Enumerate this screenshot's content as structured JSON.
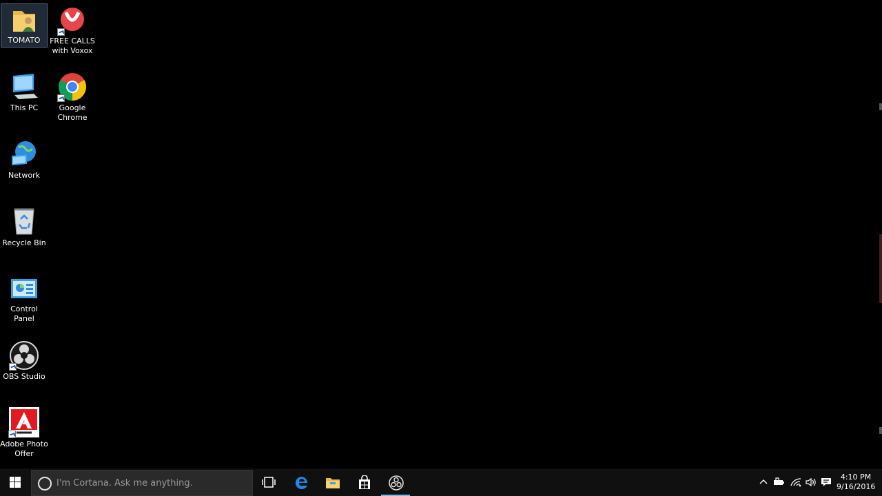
{
  "desktop_icons": [
    {
      "label": "TOMATO",
      "icon": "folder-user-icon"
    },
    {
      "label": "FREE CALLS with Voxox",
      "icon": "voxox-icon"
    },
    {
      "label": "This PC",
      "icon": "computer-icon"
    },
    {
      "label": "Google Chrome",
      "icon": "chrome-icon"
    },
    {
      "label": "Network",
      "icon": "network-icon"
    },
    {
      "label": "Recycle Bin",
      "icon": "recycle-bin-icon"
    },
    {
      "label": "Control Panel",
      "icon": "control-panel-icon"
    },
    {
      "label": "OBS Studio",
      "icon": "obs-icon"
    },
    {
      "label": "Adobe Photo Offer",
      "icon": "adobe-icon"
    }
  ],
  "taskbar": {
    "search_placeholder": "I'm Cortana. Ask me anything.",
    "apps": [
      "task-view-icon",
      "edge-icon",
      "file-explorer-icon",
      "store-icon",
      "obs-icon"
    ],
    "tray": [
      "chevron-up-icon",
      "battery-icon",
      "wifi-icon",
      "volume-icon",
      "notifications-icon"
    ],
    "time": "4:10 PM",
    "date": "9/16/2016",
    "accent": "#76b9ed"
  }
}
